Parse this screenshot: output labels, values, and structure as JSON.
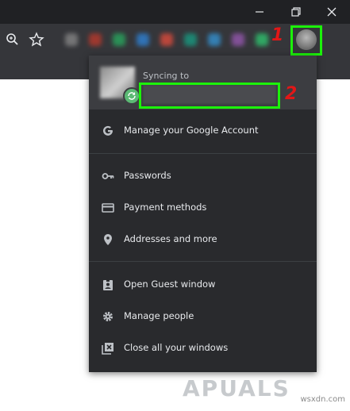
{
  "profile_menu": {
    "syncing_label": "Syncing to",
    "items": [
      {
        "label": "Manage your Google Account",
        "icon": "google-g-icon"
      },
      {
        "label": "Passwords",
        "icon": "key-icon"
      },
      {
        "label": "Payment methods",
        "icon": "credit-card-icon"
      },
      {
        "label": "Addresses and more",
        "icon": "location-pin-icon"
      },
      {
        "label": "Open Guest window",
        "icon": "guest-badge-icon"
      },
      {
        "label": "Manage people",
        "icon": "gear-icon"
      },
      {
        "label": "Close all your windows",
        "icon": "close-window-icon"
      }
    ]
  },
  "annotations": {
    "step1": "1",
    "step2": "2"
  },
  "watermark": {
    "site": "wsxdn.com",
    "brand": "APUALS"
  },
  "colors": {
    "highlight": "#1cf20a",
    "step_number": "#e21717",
    "menu_bg": "#292a2d",
    "toolbar_bg": "#35363a"
  }
}
